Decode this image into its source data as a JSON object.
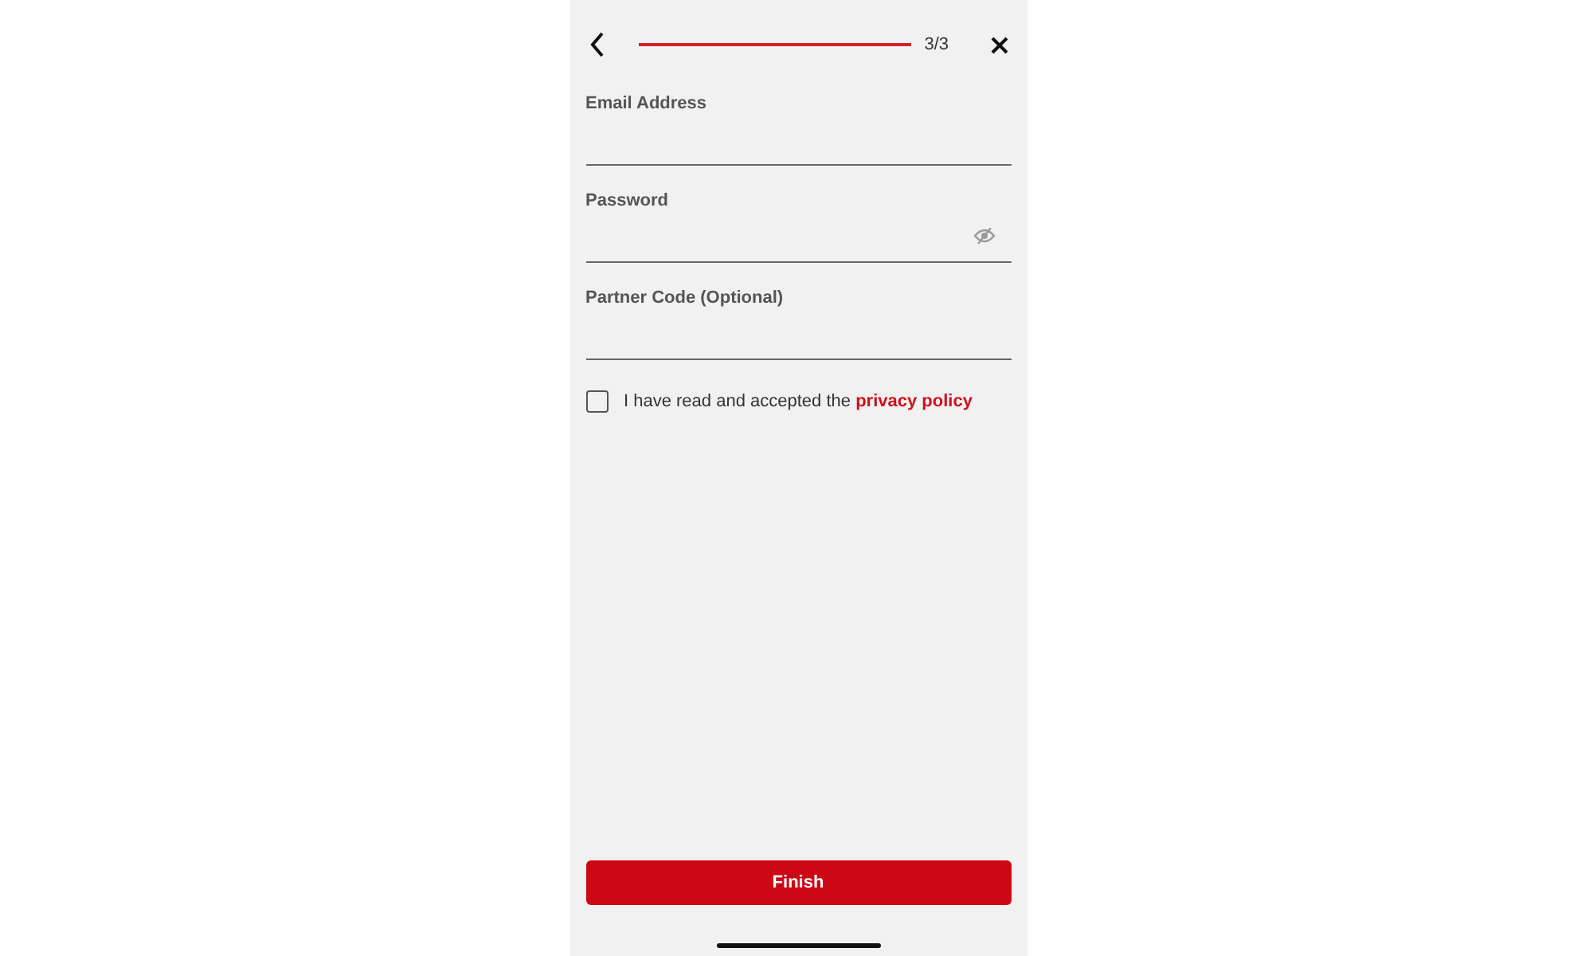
{
  "header": {
    "progress": {
      "level": 1
    },
    "step": "3/3"
  },
  "fields": [
    {
      "label": "Email Address",
      "kind": "text"
    },
    {
      "label": "Password",
      "kind": "password"
    },
    {
      "label": "Partner Code (Optional)",
      "kind": "text"
    }
  ],
  "consent": {
    "checked": false,
    "text": "I have read and accepted the",
    "link": "privacy policy"
  },
  "button": "Finish"
}
